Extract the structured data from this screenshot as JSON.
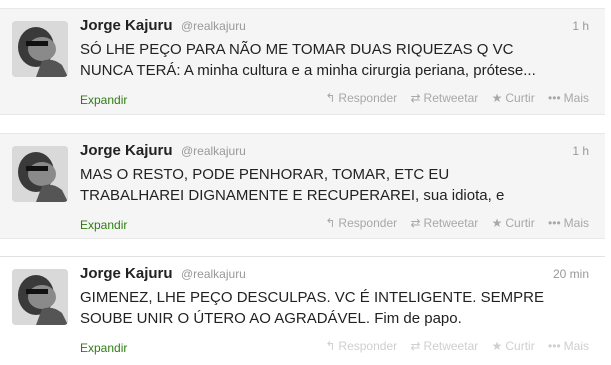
{
  "tweets": [
    {
      "name": "Jorge Kajuru",
      "handle": "@realkajuru",
      "time": "1 h",
      "lines": [
        "SÓ LHE PEÇO PARA NÃO ME TOMAR DUAS RIQUEZAS Q VC",
        "NUNCA TERÁ: A minha cultura e a minha cirurgia periana, prótese..."
      ],
      "expand": "Expandir",
      "reply": "Responder",
      "retweet": "Retweetar",
      "favorite": "Curtir",
      "more": "Mais"
    },
    {
      "name": "Jorge Kajuru",
      "handle": "@realkajuru",
      "time": "1 h",
      "lines": [
        "MAS O RESTO, PODE PENHORAR, TOMAR, ETC EU",
        "TRABALHAREI DIGNAMENTE E RECUPERAREI, sua idiota, e"
      ],
      "expand": "Expandir",
      "reply": "Responder",
      "retweet": "Retweetar",
      "favorite": "Curtir",
      "more": "Mais"
    },
    {
      "name": "Jorge Kajuru",
      "handle": "@realkajuru",
      "time": "20 min",
      "lines": [
        "GIMENEZ, LHE PEÇO DESCULPAS. VC É INTELIGENTE. SEMPRE",
        "SOUBE UNIR O ÚTERO AO AGRADÁVEL. Fim de papo."
      ],
      "expand": "Expandir",
      "reply": "Responder",
      "retweet": "Retweetar",
      "favorite": "Curtir",
      "more": "Mais"
    }
  ],
  "icons": {
    "reply": "reply-arrow-icon",
    "retweet": "retweet-icon",
    "favorite": "star-icon",
    "more": "more-dots-icon"
  }
}
